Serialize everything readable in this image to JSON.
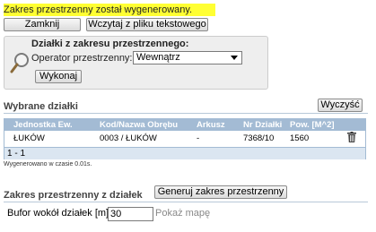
{
  "notice": {
    "message": "Zakres przestrzenny został wygenerowany.",
    "highlight_color": "#ffff33"
  },
  "toolbar": {
    "close_label": "Zamknij",
    "load_file_label": "Wczytaj z pliku tekstowego"
  },
  "filter_panel": {
    "title": "Działki z zakresu przestrzennego:",
    "operator_label": "Operator przestrzenny:",
    "operator_value": "Wewnątrz",
    "execute_label": "Wykonaj",
    "icon": "magnifier-icon"
  },
  "selected": {
    "title": "Wybrane działki",
    "clear_label": "Wyczyść",
    "columns": [
      "Jednostka Ew.",
      "Kod/Nazwa Obrębu",
      "Arkusz",
      "Nr Działki",
      "Pow. [M^2]"
    ],
    "rows": [
      {
        "unit": "ŁUKÓW",
        "precinct": "0003 / ŁUKÓW",
        "sheet": "-",
        "parcel": "7368/10",
        "area": "1560",
        "action_icon": "trash-icon"
      }
    ],
    "pager": "1 - 1",
    "generated_note": "Wygenerowano w czasie 0.01s."
  },
  "range": {
    "title": "Zakres przestrzenny z działek",
    "generate_label": "Generuj zakres przestrzenny",
    "buffer_label": "Bufor wokół działek [m]:",
    "buffer_value": "30",
    "show_map_label": "Pokaż mapę"
  }
}
